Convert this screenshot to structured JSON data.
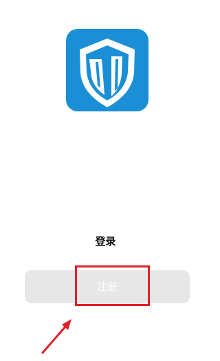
{
  "logo": {
    "icon": "shield-logo-icon",
    "background_color": "#1a8fd6",
    "shield_color": "#ffffff"
  },
  "login": {
    "label": "登录"
  },
  "register": {
    "label": "注册"
  },
  "annotation": {
    "box_color": "#e0202a",
    "arrow_color": "#e0202a"
  }
}
